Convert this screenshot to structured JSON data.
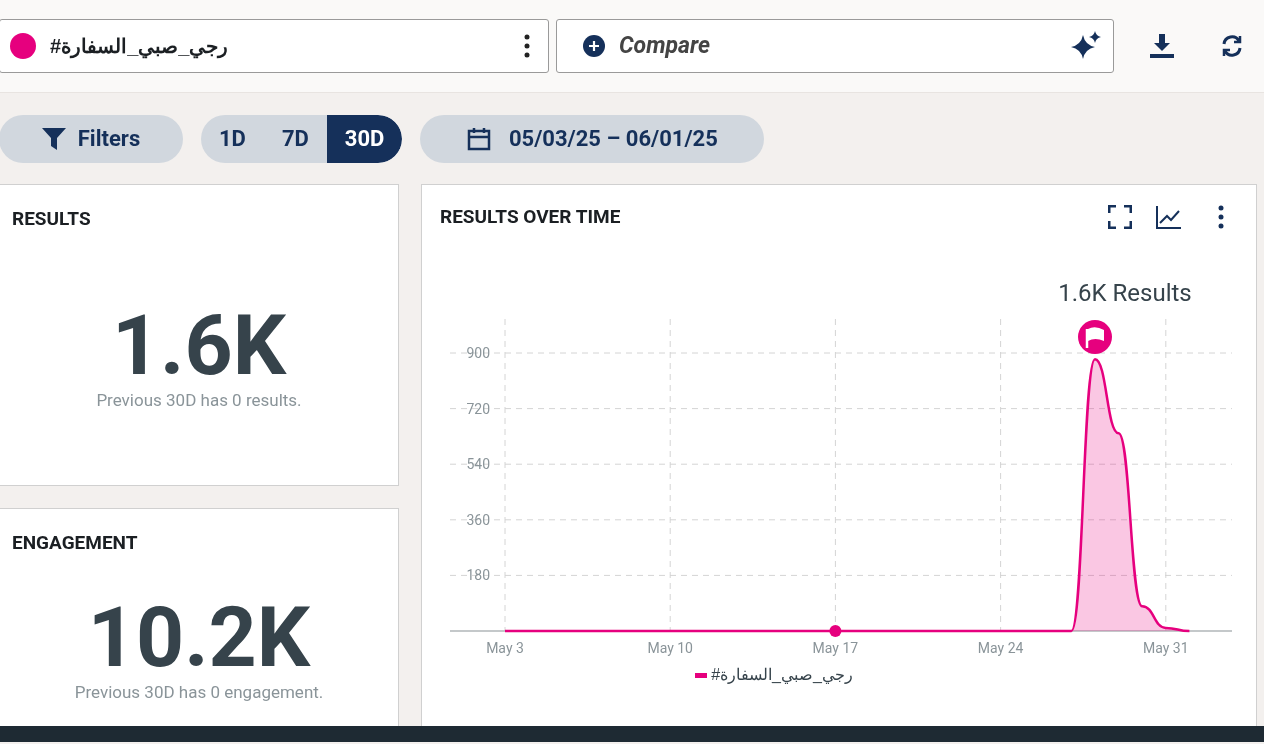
{
  "topic": {
    "color": "#e6007e",
    "label": "#رجي_صبي_السفارة"
  },
  "compare": {
    "placeholder": "Compare"
  },
  "filters": {
    "label": "Filters"
  },
  "ranges": [
    {
      "label": "1D",
      "selected": false
    },
    {
      "label": "7D",
      "selected": false
    },
    {
      "label": "30D",
      "selected": true
    }
  ],
  "date_range": "05/03/25 – 06/01/25",
  "results": {
    "title": "RESULTS",
    "value": "1.6K",
    "note": "Previous 30D has 0 results."
  },
  "engagement": {
    "title": "ENGAGEMENT",
    "value": "10.2K",
    "note": "Previous 30D has 0 engagement."
  },
  "results_over_time": {
    "title": "RESULTS OVER TIME",
    "annotation": "1.6K Results",
    "chart_data": {
      "type": "area",
      "categories": [
        "May 3",
        null,
        null,
        null,
        null,
        null,
        null,
        "May 10",
        null,
        null,
        null,
        null,
        null,
        null,
        "May 17",
        null,
        null,
        null,
        null,
        null,
        null,
        "May 24",
        null,
        null,
        null,
        null,
        null,
        null,
        "May 31",
        null
      ],
      "grid": true,
      "series": [
        {
          "name": "#رجي_صبي_السفارة",
          "color": "#e6007e",
          "values": [
            0,
            0,
            0,
            0,
            0,
            0,
            0,
            0,
            0,
            0,
            0,
            0,
            0,
            0,
            0,
            0,
            0,
            0,
            0,
            0,
            0,
            0,
            0,
            0,
            0,
            880,
            640,
            80,
            10,
            0
          ]
        }
      ],
      "ylim": [
        0,
        900
      ],
      "yticks": [
        180,
        360,
        540,
        720,
        900
      ]
    }
  }
}
